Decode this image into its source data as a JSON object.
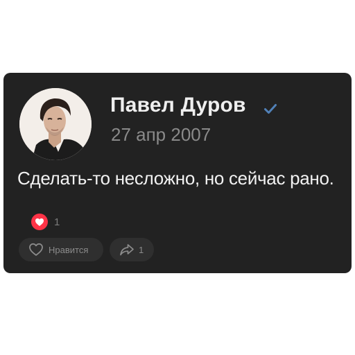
{
  "post": {
    "author": "Павел Дуров",
    "date": "27 апр 2007",
    "text": "Сделать-то несложно, но сейчас рано.",
    "reactions_count": "1"
  },
  "actions": {
    "like_label": "Нравится",
    "share_count": "1"
  },
  "icons": {
    "verified": "verified-check-icon",
    "reaction": "heart-icon",
    "like": "heart-outline-icon",
    "share": "share-arrow-icon"
  },
  "colors": {
    "card_background": "#222222",
    "verified": "#5181b8",
    "reaction_heart": "#ff3347"
  }
}
